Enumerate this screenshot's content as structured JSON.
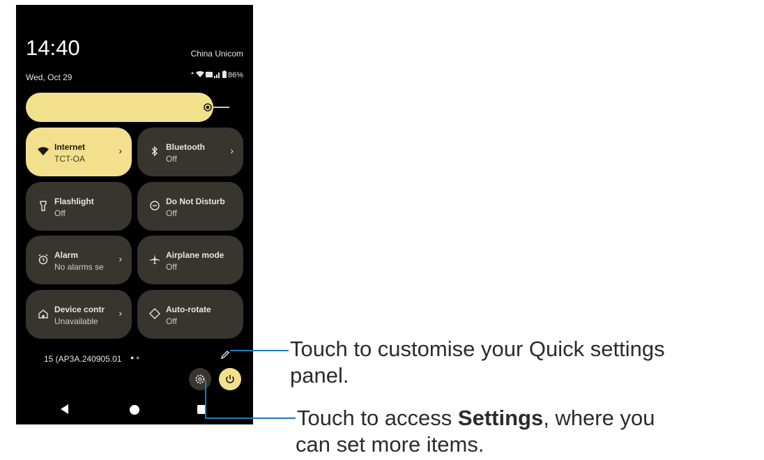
{
  "status": {
    "time": "14:40",
    "date": "Wed, Oct 29",
    "carrier": "China Unicom",
    "battery": "86%",
    "icons": [
      "data-arrows-icon",
      "wifi-icon",
      "hd-icon",
      "signal-icon",
      "battery-icon"
    ]
  },
  "brightness": {
    "level": 0.87,
    "icon": "brightness-icon"
  },
  "tiles": [
    {
      "title": "Internet",
      "subtitle": "TCT-OA",
      "icon": "wifi-icon",
      "active": true,
      "chevron": true
    },
    {
      "title": "Bluetooth",
      "subtitle": "Off",
      "icon": "bluetooth-icon",
      "active": false,
      "chevron": true
    },
    {
      "title": "Flashlight",
      "subtitle": "Off",
      "icon": "flashlight-icon",
      "active": false,
      "chevron": false
    },
    {
      "title": "Do Not Disturb",
      "subtitle": "Off",
      "icon": "do-not-disturb-icon",
      "active": false,
      "chevron": false
    },
    {
      "title": "Alarm",
      "subtitle": "No alarms se",
      "icon": "alarm-icon",
      "active": false,
      "chevron": true
    },
    {
      "title": "Airplane mode",
      "subtitle": "Off",
      "icon": "airplane-icon",
      "active": false,
      "chevron": false
    },
    {
      "title": "Device contr",
      "subtitle": "Unavailable",
      "icon": "home-icon",
      "active": false,
      "chevron": true
    },
    {
      "title": "Auto-rotate",
      "subtitle": "Off",
      "icon": "auto-rotate-icon",
      "active": false,
      "chevron": false
    }
  ],
  "footer": {
    "build": "15 (AP3A.240905.01",
    "page_dots": 2,
    "edit_icon": "pencil-icon",
    "settings_icon": "gear-icon",
    "power_icon": "power-icon"
  },
  "nav": [
    "back-icon",
    "home-icon",
    "recents-icon"
  ],
  "callouts": {
    "edit_line1": "Touch to customise your Quick settings",
    "edit_line2": "panel.",
    "settings_pre": "Touch to access ",
    "settings_bold": "Settings",
    "settings_post": ", where you",
    "settings_line2": "can set more items."
  },
  "colors": {
    "accent": "#f3e08c",
    "tile_bg": "#37352e",
    "leader": "#1f7ac0",
    "phone_bg": "#000000"
  }
}
